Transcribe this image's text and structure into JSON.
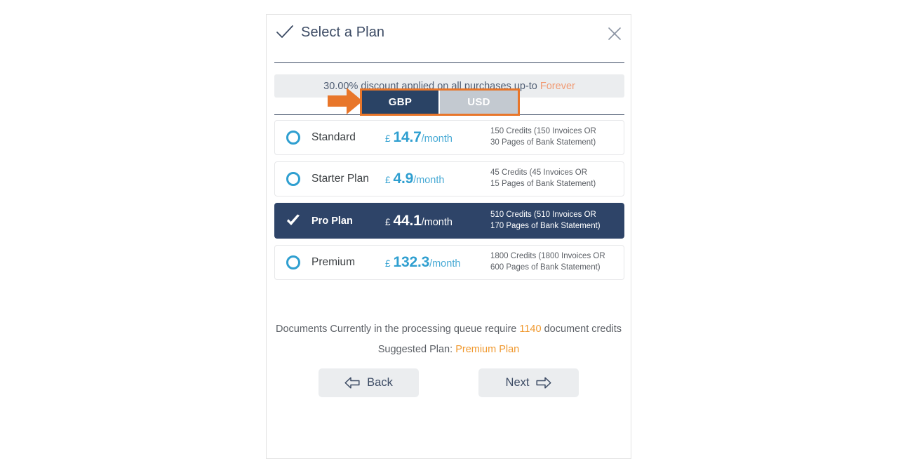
{
  "header": {
    "title": "Select a Plan",
    "check_icon": "check-icon",
    "close_icon": "close-icon"
  },
  "discount": {
    "text": "30.00% discount applied on all purchases up-to",
    "duration": "Forever",
    "duration_color": "#f09a73"
  },
  "currency": {
    "selected": "GBP",
    "options": [
      "GBP",
      "USD"
    ],
    "annotation_icon": "right-arrow-annotation",
    "annotation_color": "#e8762a"
  },
  "plans": [
    {
      "name": "Standard",
      "symbol": "£",
      "amount": "14.7",
      "period": "/month",
      "desc_line1": "150 Credits (150 Invoices OR",
      "desc_line2": "30 Pages of Bank Statement)",
      "selected": false
    },
    {
      "name": "Starter Plan",
      "symbol": "£",
      "amount": "4.9",
      "period": "/month",
      "desc_line1": "45 Credits (45 Invoices OR",
      "desc_line2": "15 Pages of Bank Statement)",
      "selected": false
    },
    {
      "name": "Pro Plan",
      "symbol": "£",
      "amount": "44.1",
      "period": "/month",
      "desc_line1": "510 Credits (510 Invoices OR",
      "desc_line2": "170 Pages of Bank Statement)",
      "selected": true
    },
    {
      "name": "Premium",
      "symbol": "£",
      "amount": "132.3",
      "period": "/month",
      "desc_line1": "1800 Credits (1800 Invoices OR",
      "desc_line2": "600 Pages of Bank Statement)",
      "selected": false
    }
  ],
  "footer": {
    "queue_prefix": "Documents Currently in the processing queue require",
    "queue_credits": "1140",
    "queue_suffix": "document credits",
    "suggested_label": "Suggested Plan:",
    "suggested_plan": "Premium Plan",
    "back_label": "Back",
    "next_label": "Next",
    "back_icon": "left-arrow-icon",
    "next_icon": "right-arrow-icon",
    "highlight_color": "#f0992f"
  },
  "theme": {
    "navy": "#2e4468",
    "accent_blue": "#2f9fd0",
    "orange": "#e8762a",
    "panel_bg": "#ffffff"
  }
}
